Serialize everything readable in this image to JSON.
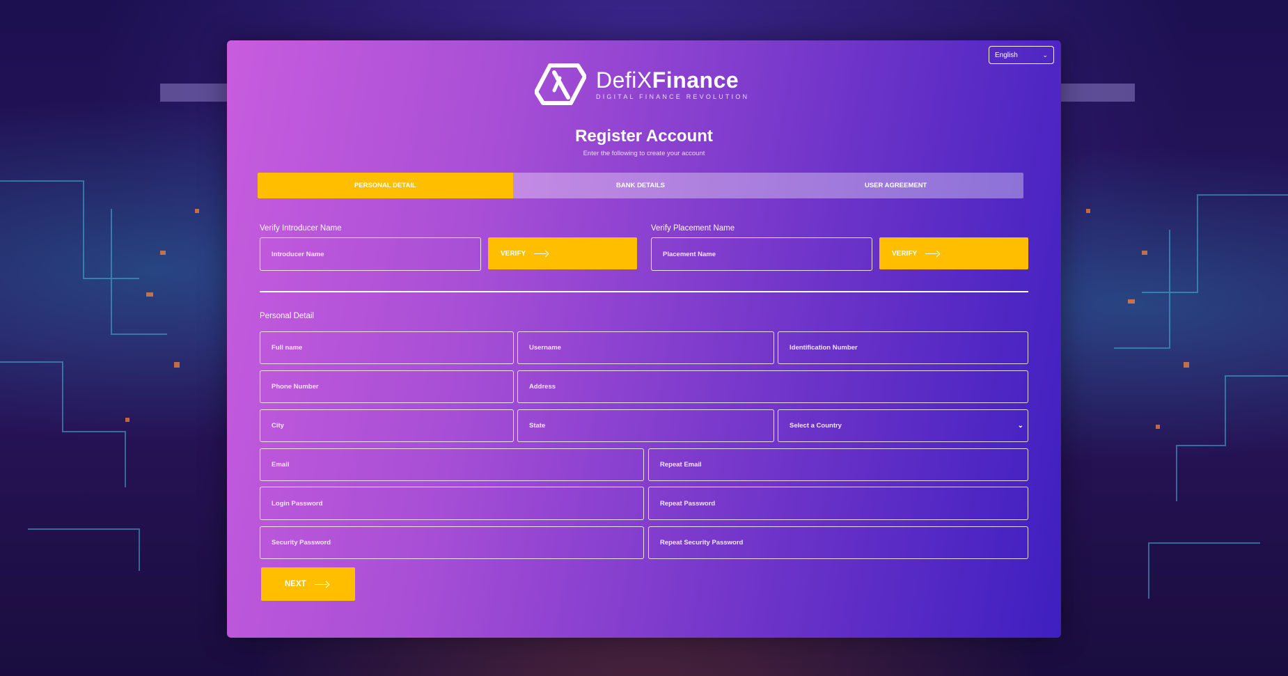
{
  "language_select": {
    "value": "English"
  },
  "brand": {
    "name_thin": "DefiX",
    "name_bold": "Finance",
    "tagline": "DIGITAL FINANCE REVOLUTION"
  },
  "header": {
    "title": "Register Account",
    "subtitle": "Enter the following to create your account"
  },
  "steps": [
    {
      "label": "PERSONAL DETAIL",
      "active": true
    },
    {
      "label": "BANK DETAILS",
      "active": false
    },
    {
      "label": "USER AGREEMENT",
      "active": false
    }
  ],
  "verify": {
    "introducer_label": "Verify Introducer Name",
    "introducer_placeholder": "Introducer Name",
    "placement_label": "Verify Placement Name",
    "placement_placeholder": "Placement Name",
    "button_label": "VERIFY"
  },
  "personal": {
    "section_label": "Personal Detail",
    "full_name": "Full name",
    "username": "Username",
    "identification_number": "Identification Number",
    "phone_number": "Phone Number",
    "address": "Address",
    "city": "City",
    "state": "State",
    "country": "Select a Country",
    "email": "Email",
    "repeat_email": "Repeat Email",
    "login_password": "Login Password",
    "repeat_password": "Repeat Password",
    "security_password": "Security Password",
    "repeat_security_password": "Repeat Security Password"
  },
  "next_button": "NEXT",
  "colors": {
    "accent": "#ffbf00",
    "card_start": "#c85cde",
    "card_end": "#3e1fc0"
  },
  "icons": {
    "arrow": "arrow-right-icon",
    "chevron": "chevron-down-icon",
    "logo": "defix-logo-icon"
  }
}
